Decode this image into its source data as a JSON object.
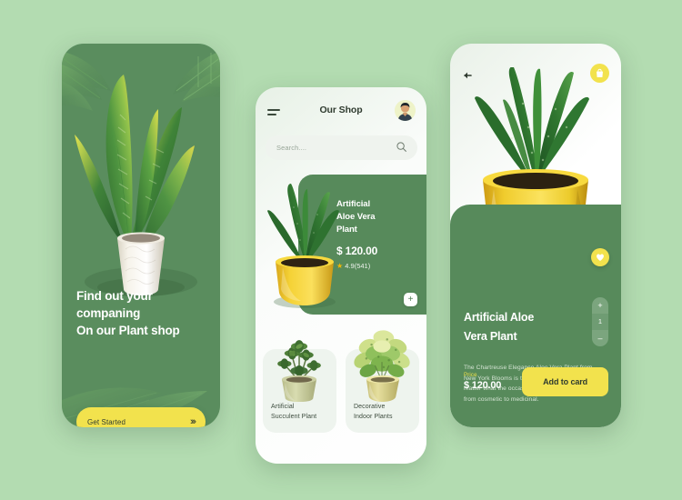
{
  "theme": {
    "background": "#b3dcb1",
    "card_green": "#578a5b",
    "dark_green": "#5a8d5e",
    "accent_yellow": "#f2e24d",
    "star_gold": "#f2b705",
    "white": "#ffffff"
  },
  "onboarding": {
    "headline_lines": [
      "Find out your",
      "companing",
      "On our Plant shop"
    ],
    "cta_label": "Get Started",
    "cta_arrows": "›››",
    "hero_alt": "snake-plant-in-white-textured-pot"
  },
  "shop": {
    "menu_icon": "hamburger-icon",
    "title": "Our Shop",
    "avatar_alt": "user-avatar",
    "search": {
      "placeholder": "Search....",
      "value": "",
      "icon": "search-icon"
    },
    "featured": {
      "name_lines": [
        "Artificial",
        "Aloe Vera",
        "Plant"
      ],
      "price": "$ 120.00",
      "rating_value": "4.9",
      "rating_count": "(541)",
      "star_icon": "star-icon",
      "add_label": "+",
      "image_alt": "aloe-vera-in-yellow-pot"
    },
    "tiles": [
      {
        "label_lines": [
          "Artificial",
          "Succulent Plant"
        ],
        "image_alt": "succulent-plant"
      },
      {
        "label_lines": [
          "Decorative",
          "Indoor Plants"
        ],
        "image_alt": "variegated-indoor-plant"
      }
    ]
  },
  "detail": {
    "back_icon": "back-arrow-icon",
    "bag_icon": "shopping-bag-icon",
    "heart_icon": "heart-icon",
    "hero_alt": "aloe-vera-in-yellow-pot-large",
    "stepper": {
      "increment_label": "+",
      "quantity": "1",
      "decrement_label": "–"
    },
    "title_lines": [
      "Artificial Aloe",
      "Vera Plant"
    ],
    "description": "The Chartreuse Elegance Aloe Vera Plant from New York Blooms is the perfect choice of gift no matter what the occasion. With a variety of uses from cosmetic to medicinal.",
    "price_label": "Price",
    "price_value": "$ 120.00",
    "add_to_cart_label": "Add to card"
  }
}
